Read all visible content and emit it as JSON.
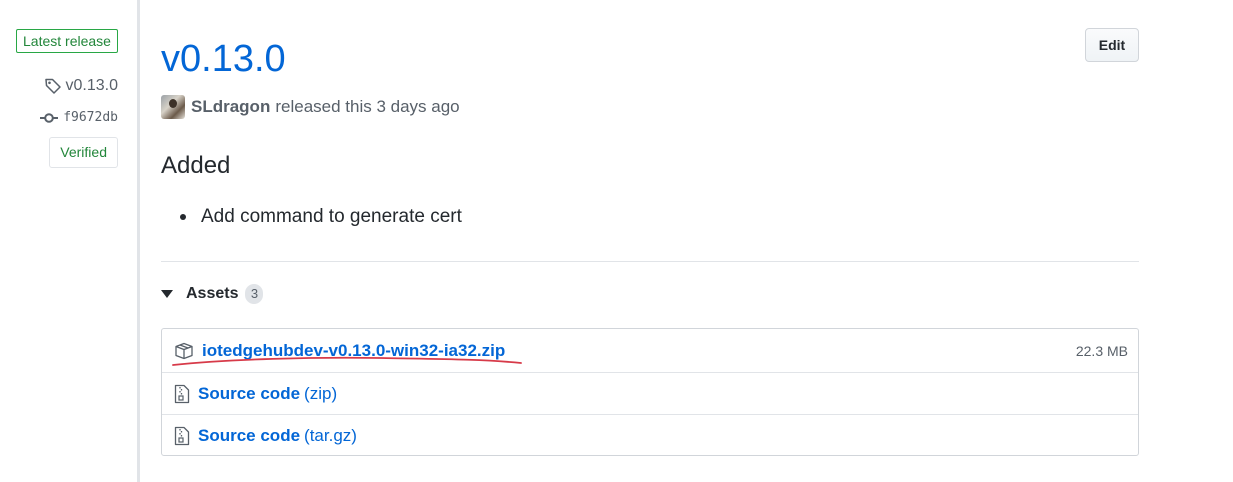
{
  "sidebar": {
    "latest_label": "Latest release",
    "tag_name": "v0.13.0",
    "commit_sha": "f9672db",
    "verified_label": "Verified"
  },
  "release": {
    "title": "v0.13.0",
    "edit_label": "Edit",
    "author": "SLdragon",
    "released_text": "released this 3 days ago",
    "section_heading": "Added",
    "notes": [
      "Add command to generate cert"
    ]
  },
  "assets": {
    "label": "Assets",
    "count": "3",
    "items": [
      {
        "name": "iotedgehubdev-v0.13.0-win32-ia32.zip",
        "suffix": "",
        "size": "22.3 MB",
        "icon": "package-icon"
      },
      {
        "name": "Source code",
        "suffix": "(zip)",
        "size": "",
        "icon": "file-zip-icon"
      },
      {
        "name": "Source code",
        "suffix": "(tar.gz)",
        "size": "",
        "icon": "file-zip-icon"
      }
    ]
  },
  "colors": {
    "link": "#0366d6",
    "verified_green": "#22863a",
    "annotation_red": "#d73a49"
  }
}
